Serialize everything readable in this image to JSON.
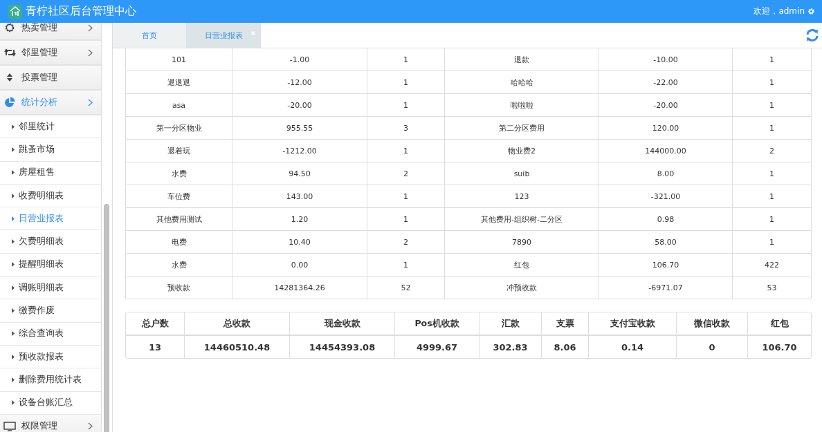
{
  "header": {
    "title": "青柠社区后台管理中心",
    "welcome": "欢迎，admin"
  },
  "sidebar": {
    "items": [
      {
        "label": "热卖管理",
        "selected": false
      },
      {
        "label": "邻里管理",
        "selected": false
      },
      {
        "label": "投票管理",
        "selected": false
      },
      {
        "label": "统计分析",
        "selected": true,
        "children": [
          {
            "label": "邻里统计",
            "selected": false
          },
          {
            "label": "跳蚤市场",
            "selected": false
          },
          {
            "label": "房屋租售",
            "selected": false
          },
          {
            "label": "收费明细表",
            "selected": false
          },
          {
            "label": "日营业报表",
            "selected": true
          },
          {
            "label": "欠费明细表",
            "selected": false
          },
          {
            "label": "提醒明细表",
            "selected": false
          },
          {
            "label": "调账明细表",
            "selected": false
          },
          {
            "label": "缴费作废",
            "selected": false
          },
          {
            "label": "综合查询表",
            "selected": false
          },
          {
            "label": "预收款报表",
            "selected": false
          },
          {
            "label": "删除费用统计表",
            "selected": false
          },
          {
            "label": "设备台账汇总",
            "selected": false
          }
        ]
      },
      {
        "label": "权限管理",
        "selected": false
      }
    ]
  },
  "tabs": [
    {
      "label": "首页",
      "selected": false,
      "closable": false
    },
    {
      "label": "日营业报表",
      "selected": true,
      "closable": true
    }
  ],
  "detail_table": {
    "rows": [
      [
        "101",
        "-1.00",
        "1",
        "退款",
        "-10.00",
        "1"
      ],
      [
        "退退退",
        "-12.00",
        "1",
        "哈哈哈",
        "-22.00",
        "1"
      ],
      [
        "asa",
        "-20.00",
        "1",
        "啦啦啦",
        "-20.00",
        "1"
      ],
      [
        "第一分区物业",
        "955.55",
        "3",
        "第二分区费用",
        "120.00",
        "1"
      ],
      [
        "退着玩",
        "-1212.00",
        "1",
        "物业费2",
        "144000.00",
        "2"
      ],
      [
        "水费",
        "94.50",
        "2",
        "suib",
        "8.00",
        "1"
      ],
      [
        "车位费",
        "143.00",
        "1",
        "123",
        "-321.00",
        "1"
      ],
      [
        "其他费用测试",
        "1.20",
        "1",
        "其他费用-组织树-二分区",
        "0.98",
        "1"
      ],
      [
        "电费",
        "10.40",
        "2",
        "7890",
        "58.00",
        "1"
      ],
      [
        "水费",
        "0.00",
        "1",
        "红包",
        "106.70",
        "422"
      ],
      [
        "预收款",
        "14281364.26",
        "52",
        "冲预收款",
        "-6971.07",
        "53"
      ]
    ]
  },
  "summary_table": {
    "columns": [
      "总户数",
      "总收款",
      "现金收款",
      "Pos机收款",
      "汇款",
      "支票",
      "支付宝收款",
      "微信收款",
      "红包"
    ],
    "values": [
      "13",
      "14460510.48",
      "14454393.08",
      "4999.67",
      "302.83",
      "8.06",
      "0.14",
      "0",
      "106.70"
    ]
  }
}
